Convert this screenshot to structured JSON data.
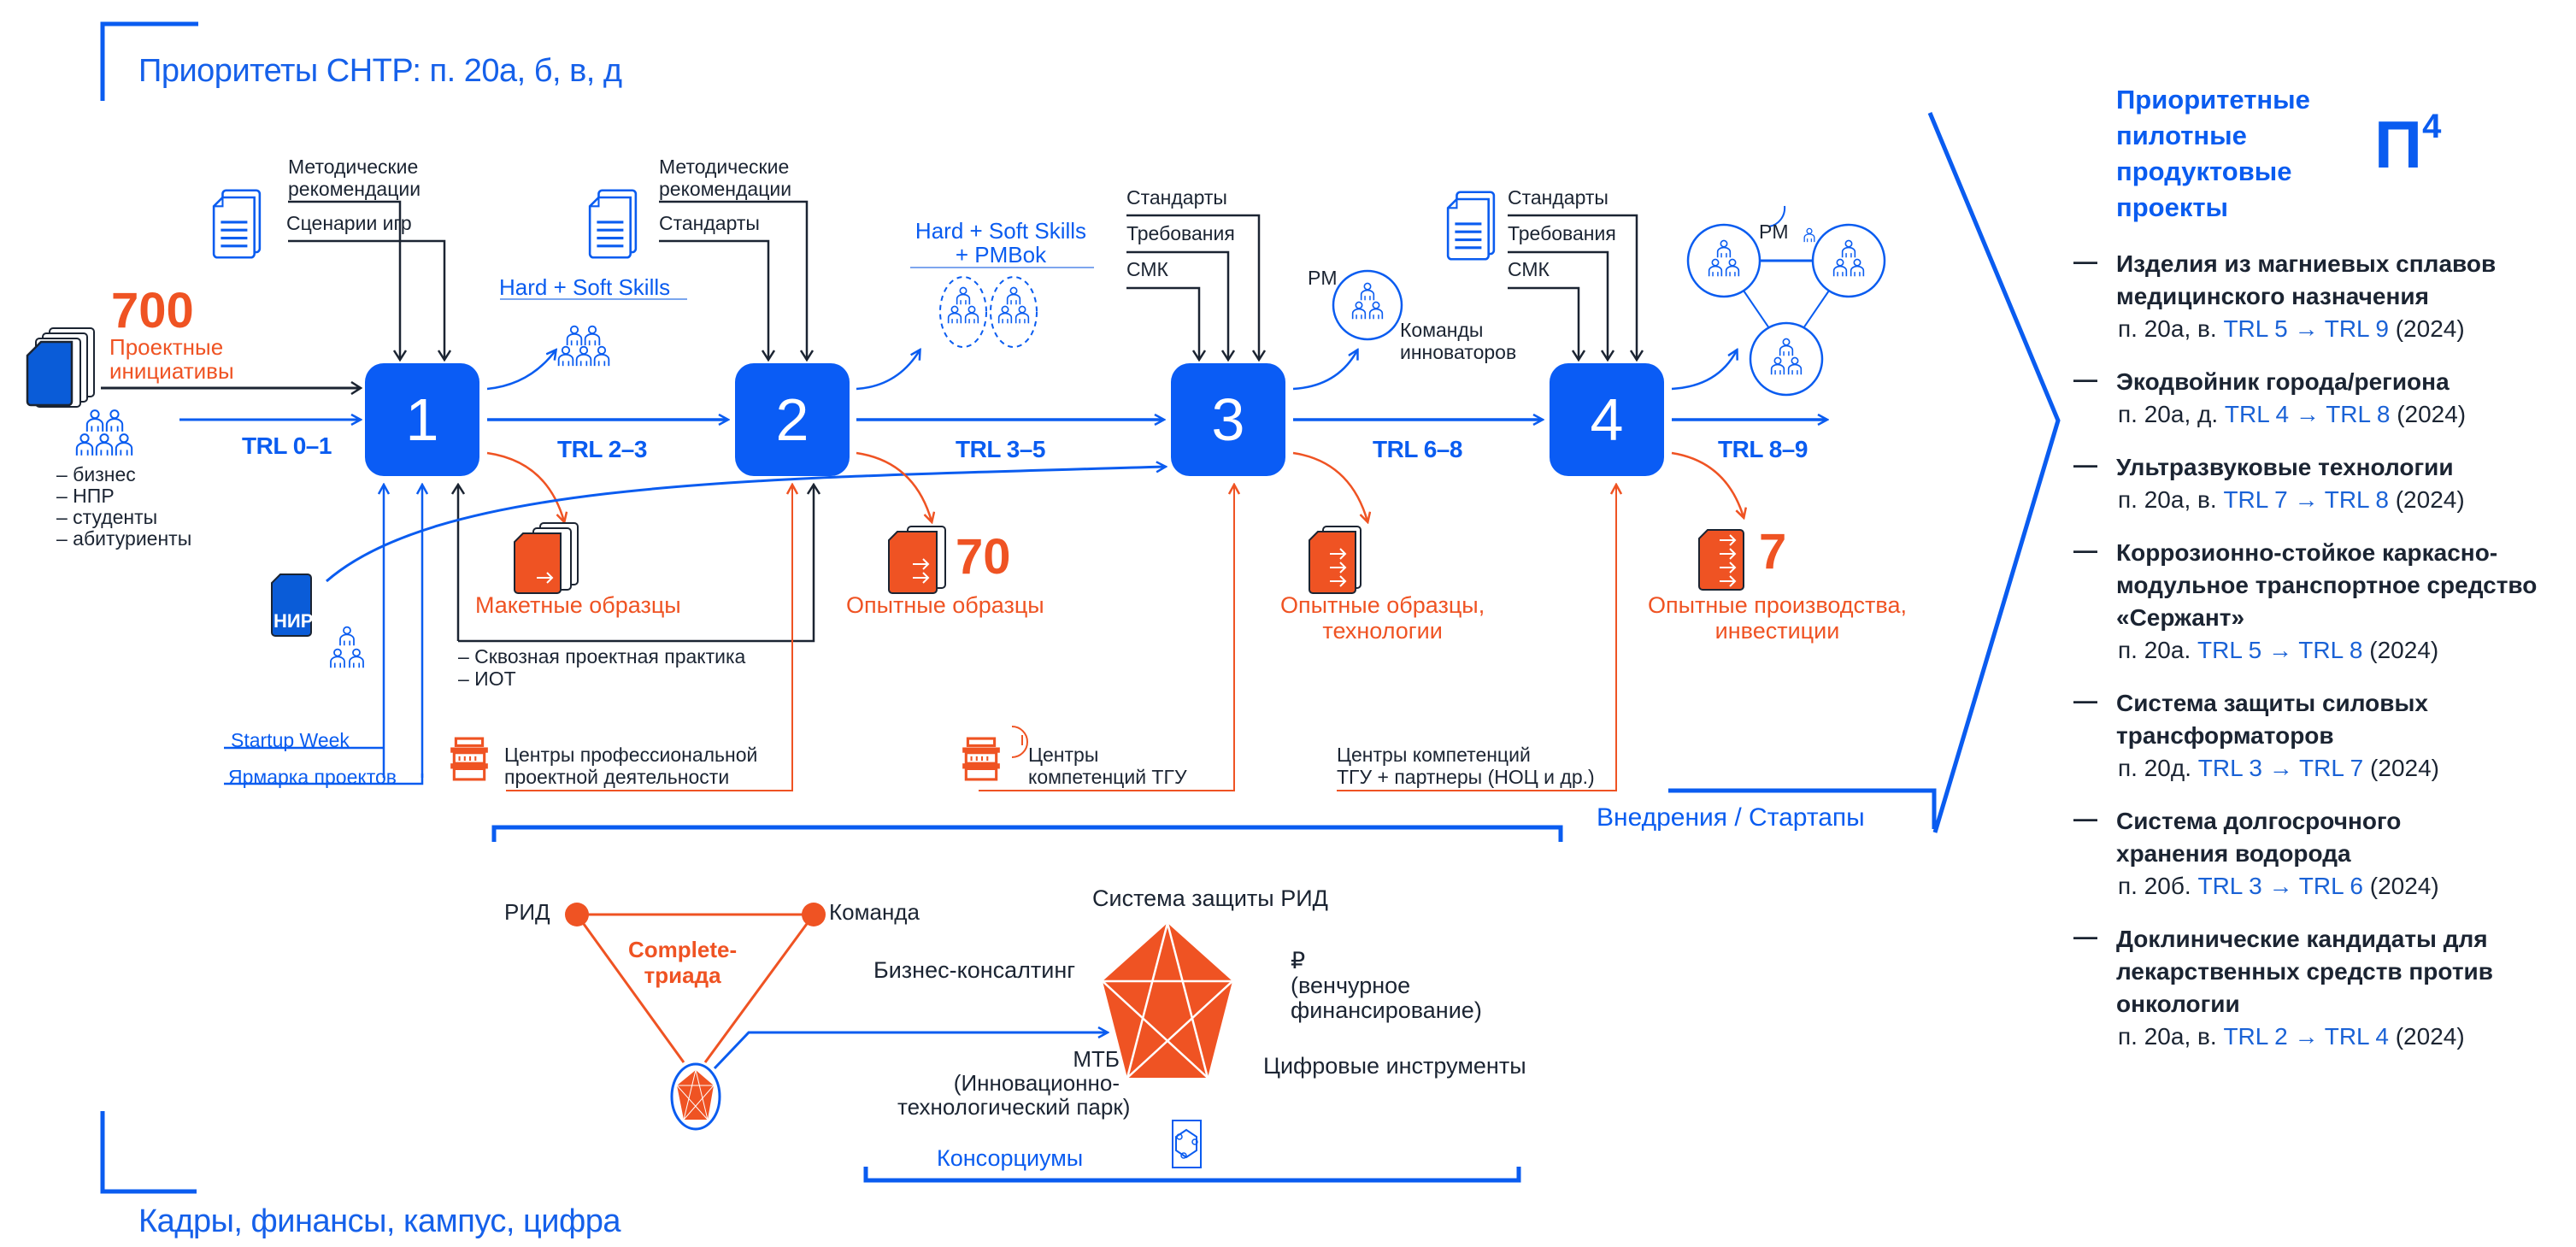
{
  "header": {
    "top_title": "Приоритеты СНТР: п. 20а, б, в, д",
    "bottom_title": "Кадры, финансы,  кампус, цифра"
  },
  "colors": {
    "primary_blue": "#0a5cf5",
    "accent_orange": "#ef5323",
    "text_dark": "#1b2432"
  },
  "input": {
    "count": "700",
    "label_line1": "Проектные",
    "label_line2": "инициативы",
    "participants": [
      "– бизнес",
      "– НПР",
      "– студенты",
      "– абитуриенты"
    ],
    "nir_label": "НИР",
    "startup_week": "Startup Week",
    "project_fair": "Ярмарка проектов"
  },
  "stages": [
    {
      "number": "1",
      "inputs": [
        "Методические",
        "рекомендации",
        "Сценарии игр"
      ],
      "trl_in": "TRL 0–1",
      "skills": "Hard + Soft Skills",
      "output": "Макетные образцы",
      "output_count": "",
      "support": [
        "– Сквозная проектная практика",
        "– ИОТ"
      ],
      "center": [
        "Центры профессиональной",
        "проектной деятельности"
      ]
    },
    {
      "number": "2",
      "inputs": [
        "Методические",
        "рекомендации",
        "Стандарты"
      ],
      "trl_in": "TRL 2–3",
      "skills_line1": "Hard + Soft Skills",
      "skills_line2": "+ PMBok",
      "output": "Опытные образцы",
      "output_count": "70",
      "center": [
        "Центры",
        "компетенций ТГУ"
      ]
    },
    {
      "number": "3",
      "inputs": [
        "Стандарты",
        "Требования",
        "СМК"
      ],
      "trl_in": "TRL 3–5",
      "pm_label": "PM",
      "teams": [
        "Команды",
        "инноваторов"
      ],
      "output_line1": "Опытные образцы,",
      "output_line2": "технологии",
      "center": [
        "Центры компетенций",
        "ТГУ + партнеры (НОЦ и др.)"
      ]
    },
    {
      "number": "4",
      "inputs": [
        "Стандарты",
        "Требования",
        "СМК"
      ],
      "trl_in": "TRL 6–8",
      "pm_label": "PM",
      "output_line1": "Опытные производства,",
      "output_line2": "инвестиции",
      "output_count": "7"
    }
  ],
  "trl_out": "TRL 8–9",
  "implementation": "Внедрения / Стартапы",
  "triad": {
    "title_line1": "Complete-",
    "title_line2": "триада",
    "vertex_left": "РИД",
    "vertex_right": "Команда"
  },
  "pentagon": {
    "top": "Система защиты РИД",
    "left": "Бизнес-консалтинг",
    "right_symbol": "₽",
    "right_line1": "(венчурное",
    "right_line2": "финансирование)",
    "bottom_right": "Цифровые инструменты",
    "bottom_left_line1": "МТБ",
    "bottom_left_line2": "(Инновационно-",
    "bottom_left_line3": "технологический парк)"
  },
  "consortia": "Консорциумы",
  "right_panel": {
    "title_lines": [
      "Приоритетные",
      "пилотные",
      "продуктовые",
      "проекты"
    ],
    "badge_letter": "П",
    "badge_sup": "4",
    "items": [
      {
        "name": "Изделия из магниевых сплавов медицинского назначения",
        "ref": "п. 20а, в.",
        "trl_from": "TRL 5",
        "trl_to": "TRL 9",
        "year": "(2024)"
      },
      {
        "name": "Экодвойник города/региона",
        "ref": "п. 20а, д.",
        "trl_from": "TRL 4",
        "trl_to": "TRL 8",
        "year": "(2024)"
      },
      {
        "name": "Ультразвуковые технологии",
        "ref": "п. 20а, в.",
        "trl_from": "TRL 7",
        "trl_to": "TRL 8",
        "year": "(2024)"
      },
      {
        "name": "Коррозионно-стойкое каркасно-модульное  транспортное средство «Сержант»",
        "ref": "п. 20а.",
        "trl_from": "TRL 5",
        "trl_to": "TRL 8",
        "year": "(2024)"
      },
      {
        "name": "Система защиты силовых трансформаторов",
        "ref": "п. 20д.",
        "trl_from": "TRL 3",
        "trl_to": "TRL 7",
        "year": "(2024)"
      },
      {
        "name": "Система долгосрочного хранения водорода",
        "ref": "п. 20б.",
        "trl_from": "TRL 3",
        "trl_to": "TRL 6",
        "year": "(2024)"
      },
      {
        "name": "Доклинические кандидаты для лекарственных средств против онкологии",
        "ref": "п. 20а, в.",
        "trl_from": "TRL 2",
        "trl_to": "TRL 4",
        "year": "(2024)"
      }
    ],
    "arrow_symbol": "→"
  }
}
